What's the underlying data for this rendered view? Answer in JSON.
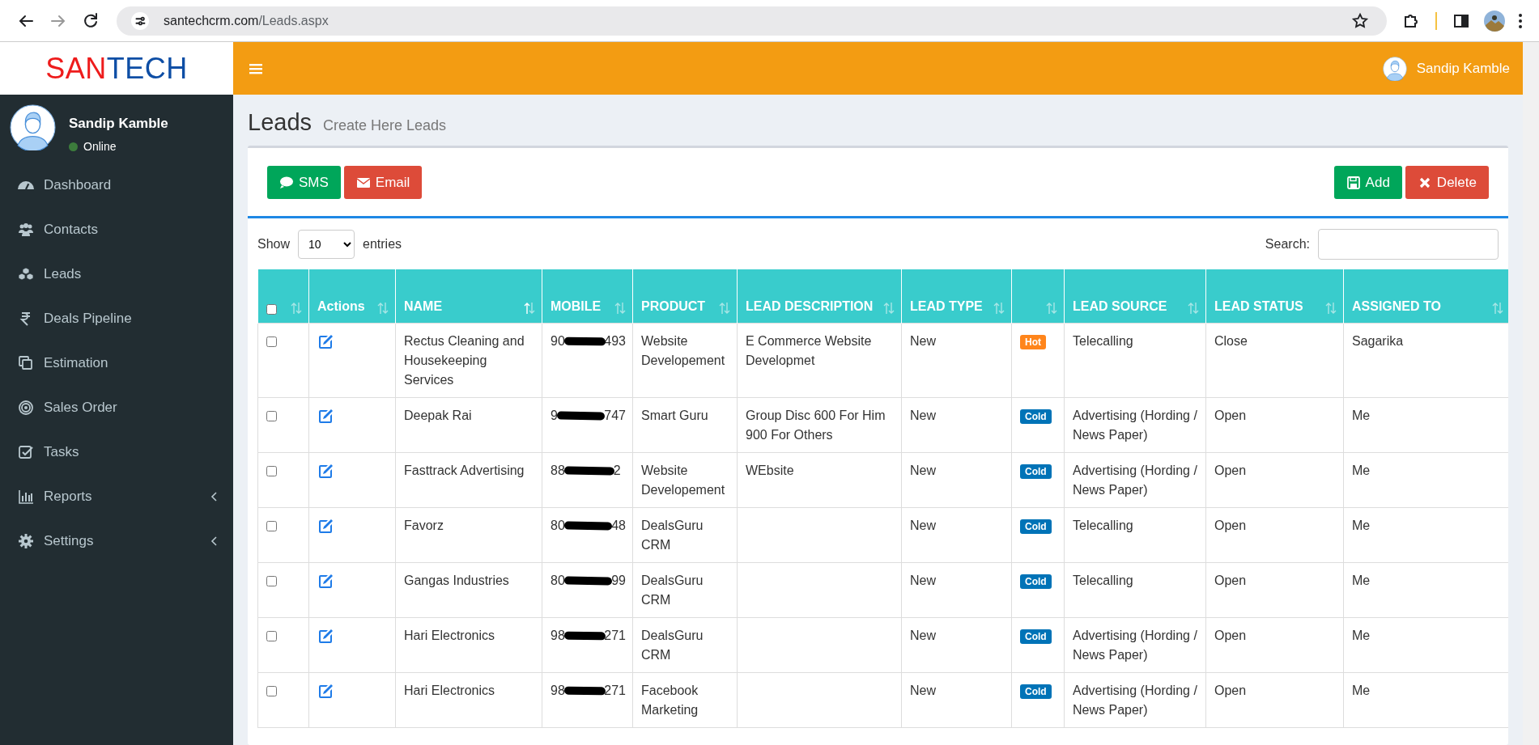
{
  "browser": {
    "url_host": "santechcrm.com",
    "url_path": "/Leads.aspx"
  },
  "logo": {
    "part_1": "SAN",
    "part_2": "TECH"
  },
  "user": {
    "name": "Sandip Kamble",
    "status": "Online"
  },
  "sidebar": {
    "items": [
      {
        "label": "Dashboard",
        "has_submenu": false
      },
      {
        "label": "Contacts",
        "has_submenu": false
      },
      {
        "label": "Leads",
        "has_submenu": false
      },
      {
        "label": "Deals Pipeline",
        "has_submenu": false
      },
      {
        "label": "Estimation",
        "has_submenu": false
      },
      {
        "label": "Sales Order",
        "has_submenu": false
      },
      {
        "label": "Tasks",
        "has_submenu": false
      },
      {
        "label": "Reports",
        "has_submenu": true
      },
      {
        "label": "Settings",
        "has_submenu": true
      }
    ]
  },
  "header": {
    "user_name": "Sandip Kamble"
  },
  "page": {
    "title": "Leads",
    "subtitle": "Create Here Leads"
  },
  "toolbar": {
    "left_buttons": [
      {
        "label": "SMS",
        "kind": "sms"
      },
      {
        "label": "Email",
        "kind": "email"
      }
    ],
    "right_buttons": [
      {
        "label": "Add",
        "kind": "add"
      },
      {
        "label": "Delete",
        "kind": "delete"
      }
    ]
  },
  "length_menu": {
    "before": "Show",
    "value": "10",
    "after": "entries"
  },
  "search": {
    "label": "Search:"
  },
  "table": {
    "select_all": {
      "checked": false
    },
    "columns": [
      {
        "label": "Actions",
        "sorted": false
      },
      {
        "label": "NAME",
        "sorted": true
      },
      {
        "label": "MOBILE",
        "sorted": false
      },
      {
        "label": "PRODUCT",
        "sorted": false
      },
      {
        "label": "LEAD DESCRIPTION",
        "sorted": false
      },
      {
        "label": "LEAD TYPE",
        "sorted": false
      },
      {
        "sorted": false
      },
      {
        "label": "LEAD SOURCE",
        "sorted": false
      },
      {
        "label": "LEAD STATUS",
        "sorted": false
      },
      {
        "label": "ASSIGNED TO",
        "sorted": false
      }
    ],
    "rows": [
      {
        "checked": false,
        "name": "Rectus Cleaning and Housekeeping Services",
        "mobile_start": "90",
        "mobile_end": "493",
        "product": "Website Developement",
        "description": "E Commerce Website Developmet",
        "lead_type": "New",
        "tag": {
          "label": "Hot",
          "color": "#ff851b"
        },
        "source": "Telecalling",
        "status": "Close",
        "assigned_to": "Sagarika"
      },
      {
        "checked": false,
        "name": "Deepak Rai",
        "mobile_start": "9",
        "mobile_end": "747",
        "product": "Smart Guru",
        "description": "Group Disc 600 For Him 900 For Others",
        "lead_type": "New",
        "tag": {
          "label": "Cold",
          "color": "#0073b7"
        },
        "source": "Advertising (Hording / News Paper)",
        "status": "Open",
        "assigned_to": "Me"
      },
      {
        "checked": false,
        "name": "Fasttrack Advertising",
        "mobile_start": "88",
        "mobile_end": "2",
        "product": "Website Developement",
        "description": "WEbsite",
        "lead_type": "New",
        "tag": {
          "label": "Cold",
          "color": "#0073b7"
        },
        "source": "Advertising (Hording / News Paper)",
        "status": "Open",
        "assigned_to": "Me"
      },
      {
        "checked": false,
        "name": "Favorz",
        "mobile_start": "80",
        "mobile_end": "48",
        "product": "DealsGuru CRM",
        "description": "",
        "lead_type": "New",
        "tag": {
          "label": "Cold",
          "color": "#0073b7"
        },
        "source": "Telecalling",
        "status": "Open",
        "assigned_to": "Me"
      },
      {
        "checked": false,
        "name": "Gangas Industries",
        "mobile_start": "80",
        "mobile_end": "99",
        "product": "DealsGuru CRM",
        "description": "",
        "lead_type": "New",
        "tag": {
          "label": "Cold",
          "color": "#0073b7"
        },
        "source": "Telecalling",
        "status": "Open",
        "assigned_to": "Me"
      },
      {
        "checked": false,
        "name": "Hari Electronics",
        "mobile_start": "98",
        "mobile_end": "271",
        "product": "DealsGuru CRM",
        "description": "",
        "lead_type": "New",
        "tag": {
          "label": "Cold",
          "color": "#0073b7"
        },
        "source": "Advertising (Hording / News Paper)",
        "status": "Open",
        "assigned_to": "Me"
      },
      {
        "checked": false,
        "name": "Hari Electronics",
        "mobile_start": "98",
        "mobile_end": "271",
        "product": "Facebook Marketing",
        "description": "",
        "lead_type": "New",
        "tag": {
          "label": "Cold",
          "color": "#0073b7"
        },
        "source": "Advertising (Hording / News Paper)",
        "status": "Open",
        "assigned_to": "Me"
      }
    ]
  }
}
